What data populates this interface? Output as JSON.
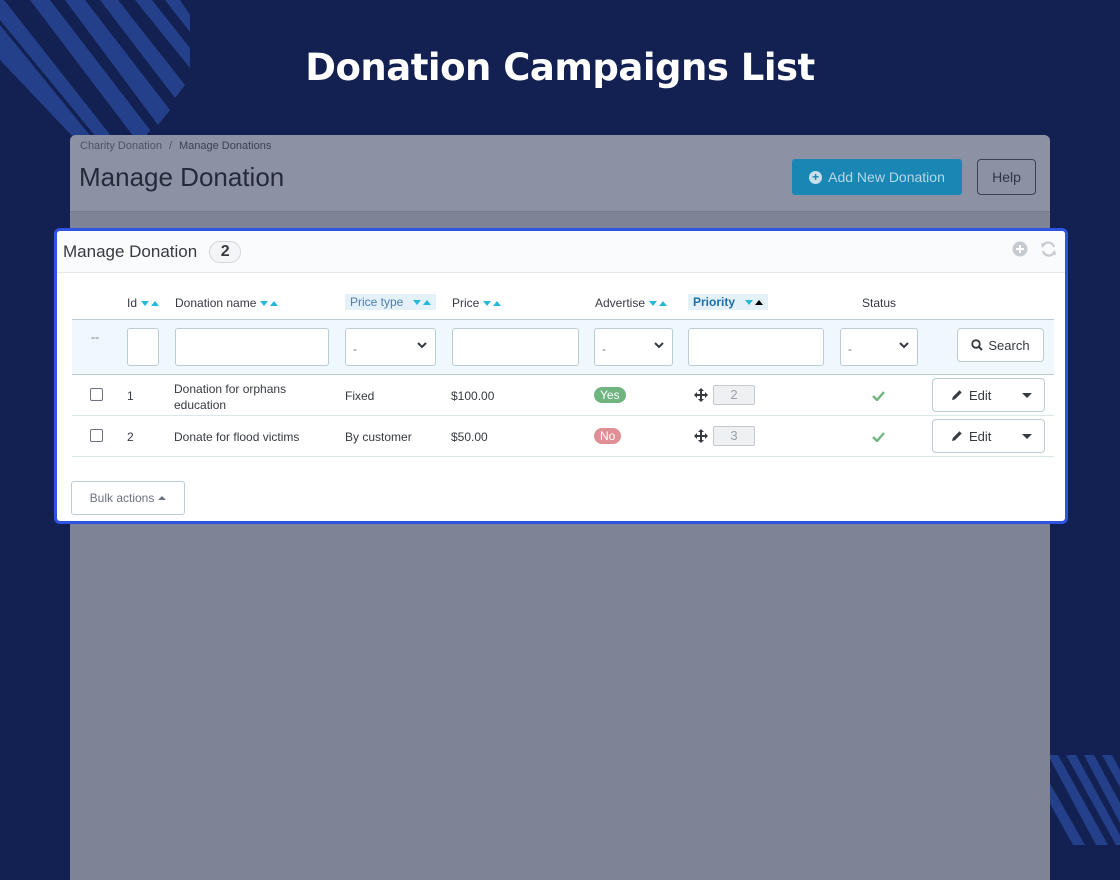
{
  "heading": "Donation Campaigns List",
  "breadcrumb": {
    "root": "Charity Donation",
    "separator": "/",
    "current": "Manage Donations"
  },
  "toolbar": {
    "title": "Manage Donation",
    "add_label": "Add New Donation",
    "help_label": "Help"
  },
  "panel": {
    "title": "Manage Donation",
    "count": "2",
    "columns": {
      "id": "Id",
      "name": "Donation name",
      "price_type": "Price type",
      "price": "Price",
      "advertise": "Advertise",
      "priority": "Priority",
      "status": "Status"
    },
    "filters": {
      "bulk_placeholder": "--",
      "price_type_value": "-",
      "advertise_value": "-",
      "status_value": "-",
      "search_label": "Search"
    },
    "rows": [
      {
        "id": "1",
        "name": "Donation for orphans education",
        "price_type": "Fixed",
        "price": "$100.00",
        "advertise": "Yes",
        "position": "2",
        "status": "enabled",
        "edit_label": "Edit"
      },
      {
        "id": "2",
        "name": "Donate for flood victims",
        "price_type": "By customer",
        "price": "$50.00",
        "advertise": "No",
        "position": "3",
        "status": "enabled",
        "edit_label": "Edit"
      }
    ],
    "bulk_label": "Bulk actions"
  },
  "colors": {
    "background": "#132152",
    "primary": "#1986b3",
    "highlight_border": "#2e54e0",
    "success": "#70b580",
    "danger": "#e08f95",
    "sort_arrow": "#25b9d7"
  },
  "icons": {
    "add": "plus-circle-icon",
    "refresh": "refresh-icon",
    "search": "search-icon",
    "edit": "pencil-icon",
    "drag": "move-icon",
    "status": "check-icon"
  }
}
